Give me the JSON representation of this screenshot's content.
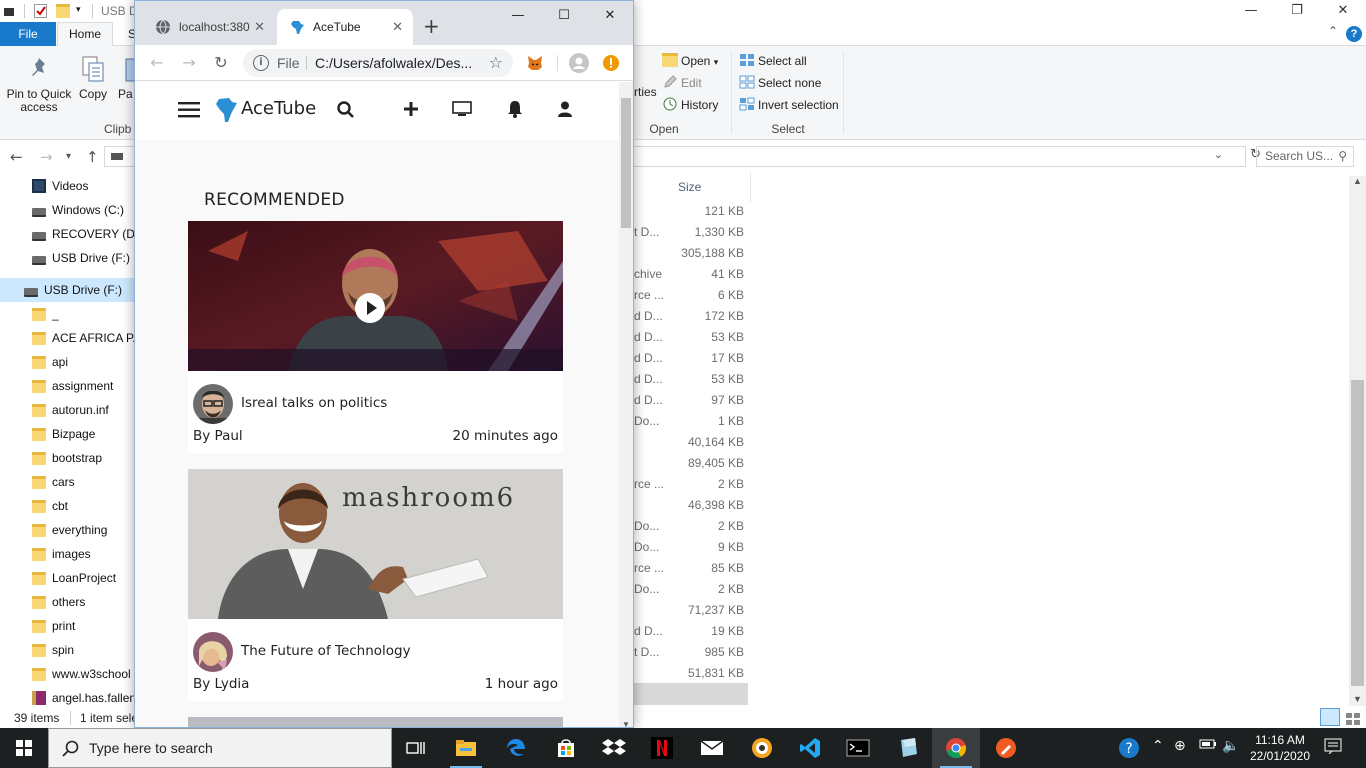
{
  "explorer": {
    "window_title": "USB D",
    "tabs": {
      "file": "File",
      "home": "Home",
      "share_partial": "S"
    },
    "ribbon": {
      "pin_label": "Pin to Quick\naccess",
      "copy_label": "Copy",
      "paste_partial": "Pa",
      "clipboard_group": "Clipb",
      "properties_partial": "rties",
      "open_label": "Open",
      "edit_label": "Edit",
      "history_label": "History",
      "open_group": "Open",
      "select_all": "Select all",
      "select_none": "Select none",
      "invert_selection": "Invert selection",
      "select_group": "Select"
    },
    "search_placeholder": "Search US...",
    "nav_items": [
      {
        "label": "Videos",
        "icon": "videos-icon"
      },
      {
        "label": "Windows (C:)",
        "icon": "drive-icon"
      },
      {
        "label": "RECOVERY (D:)",
        "icon": "drive-icon"
      },
      {
        "label": "USB Drive (F:)",
        "icon": "drive-icon"
      },
      {
        "label": "USB Drive (F:)",
        "icon": "drive-icon"
      },
      {
        "label": "_",
        "icon": "folder-icon"
      },
      {
        "label": "ACE AFRICA PA",
        "icon": "folder-icon"
      },
      {
        "label": "api",
        "icon": "folder-icon"
      },
      {
        "label": "assignment",
        "icon": "folder-icon"
      },
      {
        "label": "autorun.inf",
        "icon": "folder-icon"
      },
      {
        "label": "Bizpage",
        "icon": "folder-icon"
      },
      {
        "label": "bootstrap",
        "icon": "folder-icon"
      },
      {
        "label": "cars",
        "icon": "folder-icon"
      },
      {
        "label": "cbt",
        "icon": "folder-icon"
      },
      {
        "label": "everything",
        "icon": "folder-icon"
      },
      {
        "label": "images",
        "icon": "folder-icon"
      },
      {
        "label": "LoanProject",
        "icon": "folder-icon"
      },
      {
        "label": "others",
        "icon": "folder-icon"
      },
      {
        "label": "print",
        "icon": "folder-icon"
      },
      {
        "label": "spin",
        "icon": "folder-icon"
      },
      {
        "label": "www.w3school",
        "icon": "folder-icon"
      },
      {
        "label": "angel.has.fallen",
        "icon": "archive-icon"
      }
    ],
    "size_header": "Size",
    "rows": [
      {
        "type": "",
        "size": "121 KB"
      },
      {
        "type": "t D...",
        "size": "1,330 KB"
      },
      {
        "type": "",
        "size": "305,188 KB"
      },
      {
        "type": "chive",
        "size": "41 KB"
      },
      {
        "type": "rce ...",
        "size": "6 KB"
      },
      {
        "type": "d D...",
        "size": "172 KB"
      },
      {
        "type": "d D...",
        "size": "53 KB"
      },
      {
        "type": "d D...",
        "size": "17 KB"
      },
      {
        "type": "d D...",
        "size": "53 KB"
      },
      {
        "type": "d D...",
        "size": "97 KB"
      },
      {
        "type": "Do...",
        "size": "1 KB"
      },
      {
        "type": "",
        "size": "40,164 KB"
      },
      {
        "type": "",
        "size": "89,405 KB"
      },
      {
        "type": "rce ...",
        "size": "2 KB"
      },
      {
        "type": "",
        "size": "46,398 KB"
      },
      {
        "type": "Do...",
        "size": "2 KB"
      },
      {
        "type": "Do...",
        "size": "9 KB"
      },
      {
        "type": "rce ...",
        "size": "85 KB"
      },
      {
        "type": "Do...",
        "size": "2 KB"
      },
      {
        "type": "",
        "size": "71,237 KB"
      },
      {
        "type": "d D...",
        "size": "19 KB"
      },
      {
        "type": "t D...",
        "size": "985 KB"
      },
      {
        "type": "",
        "size": "51,831 KB"
      }
    ],
    "status": {
      "items": "39 items",
      "selected": "1 item sele"
    }
  },
  "chrome": {
    "tabs": [
      {
        "label": "localhost:380",
        "icon": "globe-icon",
        "active": false
      },
      {
        "label": "AceTube",
        "icon": "africa-icon",
        "active": true
      }
    ],
    "omnibox": {
      "scheme": "File",
      "url": "C:/Users/afolwalex/Des..."
    }
  },
  "acetube": {
    "brand": "AceTube",
    "section_heading": "RECOMMENDED",
    "videos": [
      {
        "title": "Isreal talks on politics",
        "author": "By Paul",
        "time": "20 minutes ago"
      },
      {
        "title": "The Future of Technology",
        "author": "By Lydia",
        "time": "1 hour ago"
      }
    ],
    "thumb2_sign": "mashroom6"
  },
  "taskbar": {
    "search_placeholder": "Type here to search",
    "time": "11:16 AM",
    "date": "22/01/2020"
  },
  "colors": {
    "explorer_accent": "#1979ca",
    "taskbar_bg": "#1d2021",
    "chrome_tabstrip": "#dee1e6"
  }
}
